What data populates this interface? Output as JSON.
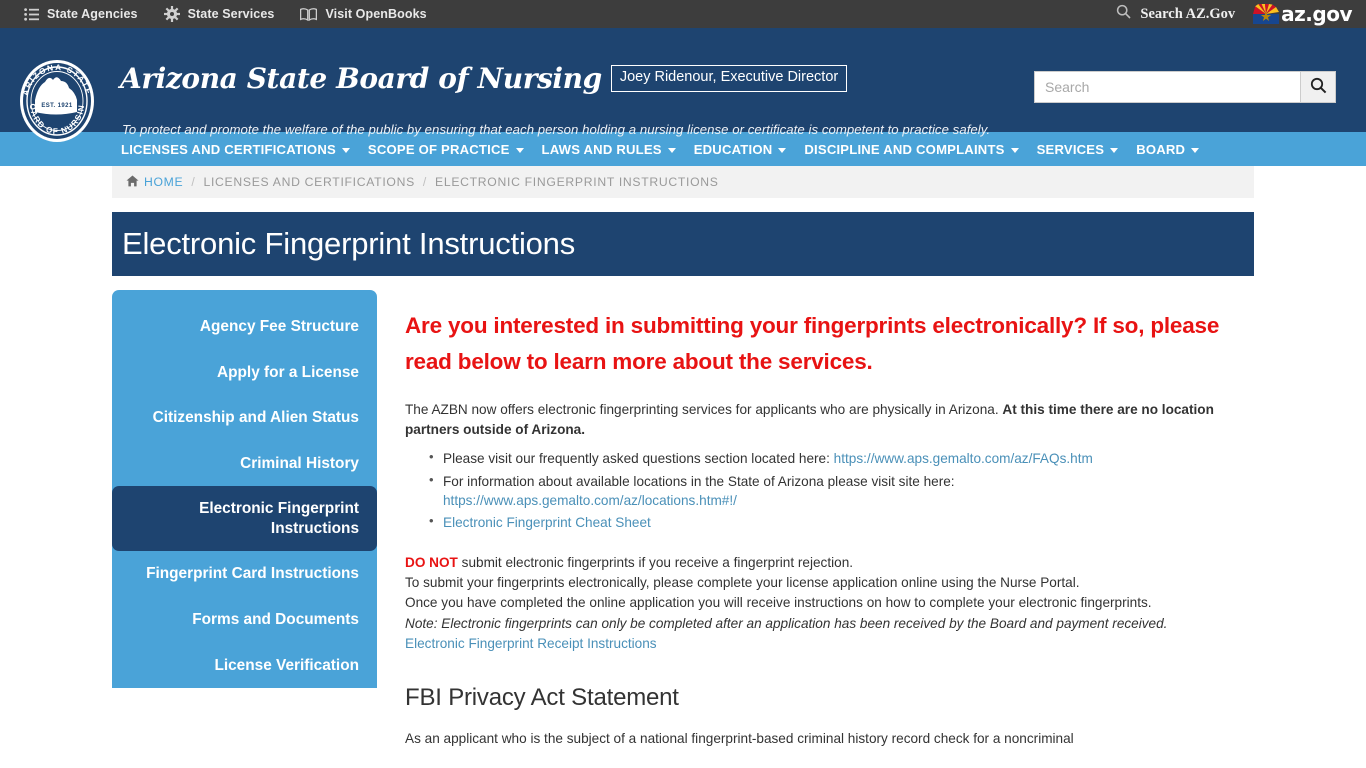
{
  "state_bar": {
    "items": [
      {
        "label": "State Agencies",
        "icon": "list-icon"
      },
      {
        "label": "State Services",
        "icon": "gear-icon"
      },
      {
        "label": "Visit OpenBooks",
        "icon": "book-icon"
      }
    ],
    "search_label": "Search AZ.Gov",
    "logo_text": "az.gov"
  },
  "header": {
    "site_title": "Arizona State Board of Nursing",
    "director": "Joey Ridenour, Executive Director",
    "mission": "To protect and promote the welfare of the public by ensuring that each person holding a nursing license or certificate is competent to practice safely.",
    "seal": {
      "top_text": "ARIZONA STATE",
      "bottom_text": "BOARD OF NURSING",
      "est": "EST. 1921"
    },
    "search": {
      "placeholder": "Search",
      "value": "",
      "button_icon": "search-icon"
    }
  },
  "nav": {
    "items": [
      "LICENSES AND CERTIFICATIONS",
      "SCOPE OF PRACTICE",
      "LAWS AND RULES",
      "EDUCATION",
      "DISCIPLINE AND COMPLAINTS",
      "SERVICES",
      "BOARD"
    ]
  },
  "breadcrumb": {
    "home": "HOME",
    "parent": "LICENSES AND CERTIFICATIONS",
    "current": "ELECTRONIC FINGERPRINT INSTRUCTIONS",
    "separator": "/"
  },
  "page": {
    "title": "Electronic Fingerprint Instructions"
  },
  "sidebar": {
    "items": [
      {
        "label": "Agency Fee Structure",
        "active": false
      },
      {
        "label": "Apply for a License",
        "active": false
      },
      {
        "label": "Citizenship and Alien Status",
        "active": false
      },
      {
        "label": "Criminal History",
        "active": false
      },
      {
        "label": "Electronic Fingerprint Instructions",
        "active": true
      },
      {
        "label": "Fingerprint Card Instructions",
        "active": false
      },
      {
        "label": "Forms and Documents",
        "active": false
      },
      {
        "label": "License Verification",
        "active": false
      }
    ]
  },
  "main": {
    "lead": "Are you interested in submitting your fingerprints electronically? If so, please read below to learn more about the services.",
    "intro_normal": "The AZBN now offers electronic fingerprinting services for applicants who are physically in Arizona. ",
    "intro_bold": "At this time there are no location partners outside of Arizona.",
    "bullets": [
      {
        "text": "Please visit our frequently asked questions section located here: ",
        "link": "https://www.aps.gemalto.com/az/FAQs.htm",
        "link_after": true
      },
      {
        "text": "For information about available locations in the State of Arizona please visit site here:",
        "link": "https://www.aps.gemalto.com/az/locations.htm#!/",
        "link_after": false
      },
      {
        "text": "",
        "link": "Electronic Fingerprint Cheat Sheet",
        "link_after": true
      }
    ],
    "donot_label": "DO NOT",
    "donot_rest": " submit electronic fingerprints if you receive a fingerprint rejection.",
    "line_2": "To submit your fingerprints electronically, please complete your license application online using the Nurse Portal.",
    "line_3": "Once you have completed the online application you will receive instructions on how to complete your electronic fingerprints.",
    "note": "Note: Electronic fingerprints can only be completed after an application has been received by the Board and payment received.",
    "receipt_link": "Electronic Fingerprint Receipt Instructions",
    "fbi_heading": "FBI Privacy Act Statement",
    "fbi_text": "As an applicant who is the subject of a national fingerprint-based criminal history record check for a noncriminal"
  },
  "colors": {
    "navy": "#1e4470",
    "sky": "#4aa3d8",
    "red": "#e81313",
    "link": "#4a90b8",
    "topbar": "#3d3d3d"
  }
}
